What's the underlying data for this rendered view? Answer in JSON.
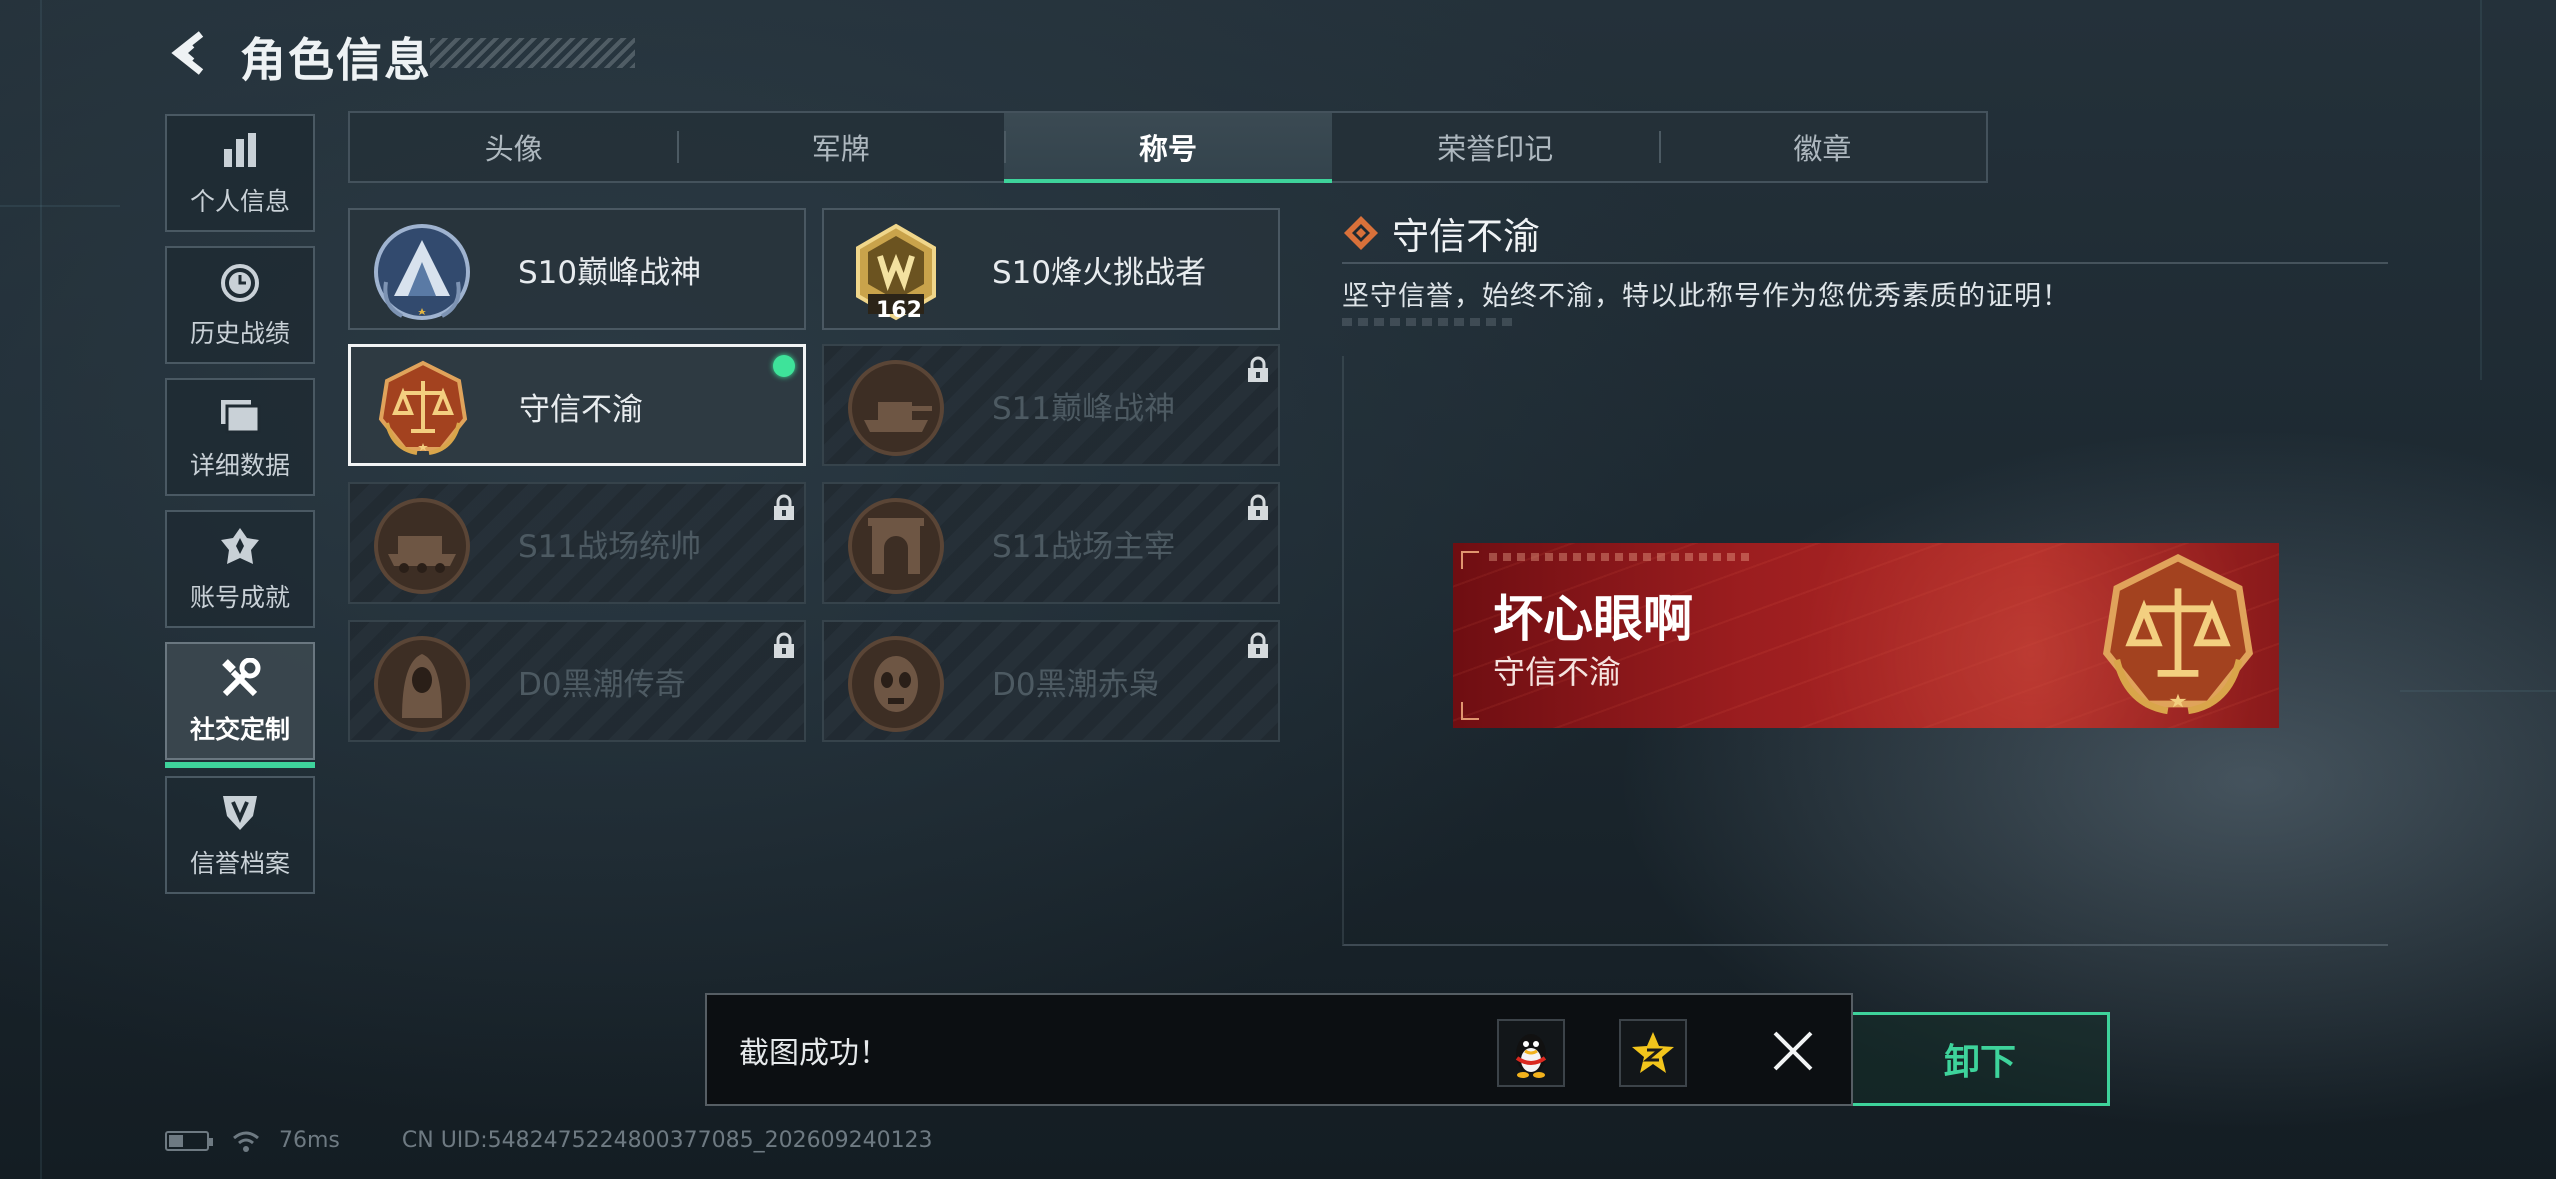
{
  "header": {
    "title": "角色信息",
    "back_icon": "back-arrow-icon"
  },
  "sidebar": {
    "items": [
      {
        "label": "个人信息",
        "icon": "bar-chart-icon",
        "active": false
      },
      {
        "label": "历史战绩",
        "icon": "clock-icon",
        "active": false
      },
      {
        "label": "详细数据",
        "icon": "folder-icon",
        "active": false
      },
      {
        "label": "账号成就",
        "icon": "trophy-icon",
        "active": false
      },
      {
        "label": "社交定制",
        "icon": "tools-icon",
        "active": true
      },
      {
        "label": "信誉档案",
        "icon": "shield-icon",
        "active": false
      }
    ]
  },
  "tabs": [
    {
      "label": "头像",
      "active": false
    },
    {
      "label": "军牌",
      "active": false
    },
    {
      "label": "称号",
      "active": true
    },
    {
      "label": "荣誉印记",
      "active": false
    },
    {
      "label": "徽章",
      "active": false
    }
  ],
  "titles": [
    {
      "name": "S10巅峰战神",
      "medal": "s10-peak-medal-icon",
      "locked": false,
      "selected": false,
      "equipped": false
    },
    {
      "name": "S10烽火挑战者",
      "medal": "s10-challenger-medal-icon",
      "locked": false,
      "selected": false,
      "equipped": false,
      "medal_level": "162"
    },
    {
      "name": "守信不渝",
      "medal": "scales-medal-icon",
      "locked": false,
      "selected": true,
      "equipped": true
    },
    {
      "name": "S11巅峰战神",
      "medal": "tank-medal-icon",
      "locked": true,
      "selected": false,
      "equipped": false
    },
    {
      "name": "S11战场统帅",
      "medal": "armored-vehicle-medal-icon",
      "locked": true,
      "selected": false,
      "equipped": false
    },
    {
      "name": "S11战场主宰",
      "medal": "arch-medal-icon",
      "locked": true,
      "selected": false,
      "equipped": false
    },
    {
      "name": "D0黑潮传奇",
      "medal": "hooded-figure-medal-icon",
      "locked": true,
      "selected": false,
      "equipped": false
    },
    {
      "name": "D0黑潮赤枭",
      "medal": "skull-mask-medal-icon",
      "locked": true,
      "selected": false,
      "equipped": false
    }
  ],
  "detail": {
    "title": "守信不渝",
    "description": "坚守信誉，始终不渝，特以此称号作为您优秀素质的证明！"
  },
  "preview_banner": {
    "player_name": "坏心眼啊",
    "title": "守信不渝",
    "color": "#a8231f"
  },
  "unequip_button": {
    "label": "卸下"
  },
  "toast": {
    "message": "截图成功！",
    "share_qq_icon": "qq-penguin-icon",
    "share_qzone_icon": "qzone-star-icon",
    "close_icon": "close-icon"
  },
  "status": {
    "ping": "76ms",
    "uid": "CN UID:5482475224800377085_202609240123"
  },
  "colors": {
    "accent": "#3ed39b",
    "selected_border": "#f2f4f5",
    "banner_red": "#a8231f"
  }
}
